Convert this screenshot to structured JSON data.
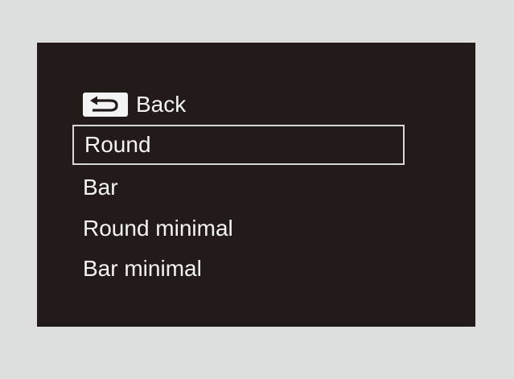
{
  "menu": {
    "back_label": "Back",
    "items": [
      {
        "label": "Round",
        "selected": true
      },
      {
        "label": "Bar",
        "selected": false
      },
      {
        "label": "Round minimal",
        "selected": false
      },
      {
        "label": "Bar minimal",
        "selected": false
      }
    ]
  },
  "icons": {
    "back": "return-arrow-icon"
  },
  "colors": {
    "screen_background": "#231b1a",
    "page_background": "#dcdfde",
    "text": "#f4f4f4",
    "selection_border": "#d8d8d8"
  }
}
